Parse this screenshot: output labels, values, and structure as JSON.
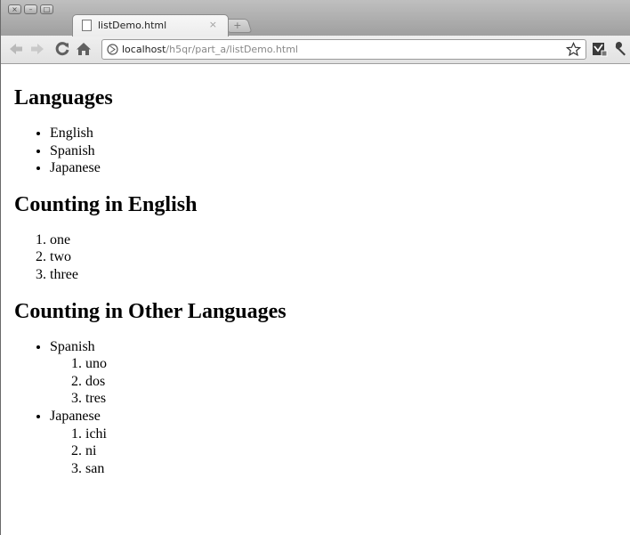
{
  "browser": {
    "tab_title": "listDemo.html",
    "tab_close": "×",
    "new_tab": "+",
    "window_buttons": [
      "×",
      "–",
      "□"
    ],
    "url": {
      "host": "localhost",
      "path": "/h5qr/part_a/listDemo.html"
    },
    "toolbar_icons": [
      "back-icon",
      "forward-icon",
      "reload-icon",
      "home-icon",
      "star-icon",
      "page-menu-icon",
      "wrench-icon"
    ]
  },
  "page": {
    "sections": [
      {
        "heading": "Languages",
        "items": [
          "English",
          "Spanish",
          "Japanese"
        ]
      },
      {
        "heading": "Counting in English",
        "items": [
          "one",
          "two",
          "three"
        ]
      },
      {
        "heading": "Counting in Other Languages",
        "groups": [
          {
            "label": "Spanish",
            "items": [
              "uno",
              "dos",
              "tres"
            ]
          },
          {
            "label": "Japanese",
            "items": [
              "ichi",
              "ni",
              "san"
            ]
          }
        ]
      }
    ]
  }
}
